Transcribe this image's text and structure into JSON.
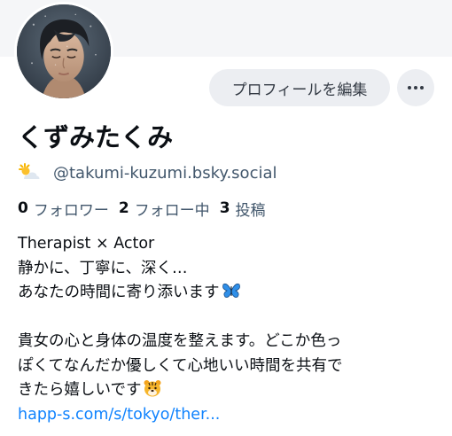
{
  "profile": {
    "display_name": "くずみたくみ",
    "handle": "@takumi-kuzumi.bsky.social",
    "edit_button_label": "プロフィールを編集",
    "more_button_icon": "ellipsis-icon",
    "avatar_icon": "profile-photo",
    "handle_badge_icon": "sun-behind-cloud-icon"
  },
  "stats": [
    {
      "count": "0",
      "label": "フォロワー"
    },
    {
      "count": "2",
      "label": "フォロー中"
    },
    {
      "count": "3",
      "label": "投稿"
    }
  ],
  "bio": {
    "line1": "Therapist × Actor",
    "line2": "静かに、丁寧に、深く…",
    "line3": "あなたの時間に寄り添います",
    "line3_emoji": "butterfly-icon",
    "line4": "貴女の心と身体の温度を整えます。どこか色っ",
    "line5": "ぽくてなんだか優しくて心地いい時間を共有で",
    "line6": "きたら嬉しいです",
    "line6_emoji": "tiger-face-icon",
    "link": "happ-s.com/s/tokyo/ther..."
  },
  "colors": {
    "link": "#1083fe",
    "secondary_text": "#42576c",
    "button_bg": "#eceef2",
    "banner_bg": "#f5f6f8"
  }
}
